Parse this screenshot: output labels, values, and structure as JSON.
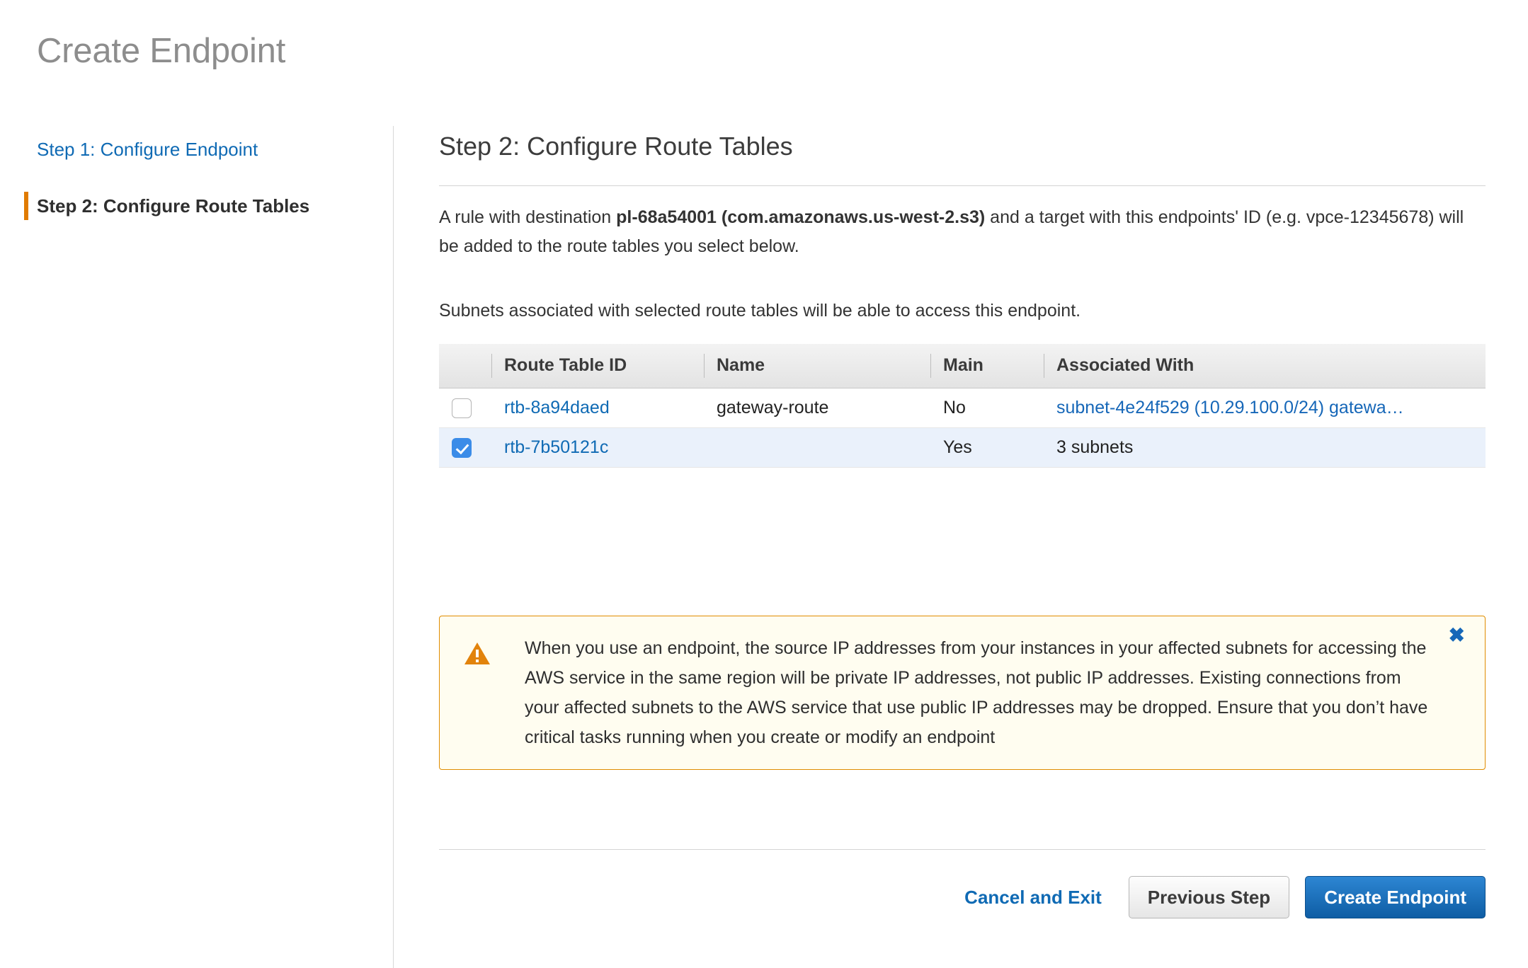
{
  "header": {
    "title": "Create Endpoint"
  },
  "sidebar": {
    "items": [
      {
        "label": "Step 1: Configure Endpoint",
        "current": false
      },
      {
        "label": "Step 2: Configure Route Tables",
        "current": true
      }
    ]
  },
  "main": {
    "step_heading": "Step 2: Configure Route Tables",
    "rule_text_prefix": "A rule with destination ",
    "rule_text_bold": "pl-68a54001 (com.amazonaws.us-west-2.s3)",
    "rule_text_suffix": " and a target with this endpoints' ID (e.g. vpce-12345678) will be added to the route tables you select below.",
    "subnets_text": "Subnets associated with selected route tables will be able to access this endpoint."
  },
  "table": {
    "columns": [
      "",
      "Route Table ID",
      "Name",
      "Main",
      "Associated With"
    ],
    "rows": [
      {
        "checked": false,
        "route_table_id": "rtb-8a94daed",
        "name": "gateway-route",
        "main": "No",
        "associated_with": "subnet-4e24f529 (10.29.100.0/24) gatewa…",
        "associated_is_link": true
      },
      {
        "checked": true,
        "route_table_id": "rtb-7b50121c",
        "name": "",
        "main": "Yes",
        "associated_with": "3 subnets",
        "associated_is_link": false
      }
    ]
  },
  "alert": {
    "icon": "warning-triangle-icon",
    "message": "When you use an endpoint, the source IP addresses from your instances in your affected subnets for accessing the AWS service in the same region will be private IP addresses, not public IP addresses. Existing connections from your affected subnets to the AWS service that use public IP addresses may be dropped. Ensure that you don’t have critical tasks running when you create or modify an endpoint",
    "close_label": "✖"
  },
  "footer": {
    "cancel_label": "Cancel and Exit",
    "previous_label": "Previous Step",
    "create_label": "Create Endpoint"
  },
  "colors": {
    "link_blue": "#0f6ab4",
    "accent_orange": "#e07b00",
    "primary_button_blue": "#0e5da4",
    "warning_bg": "#fffdf0",
    "warning_border": "#e08c00",
    "selected_row": "#eaf1fb"
  }
}
